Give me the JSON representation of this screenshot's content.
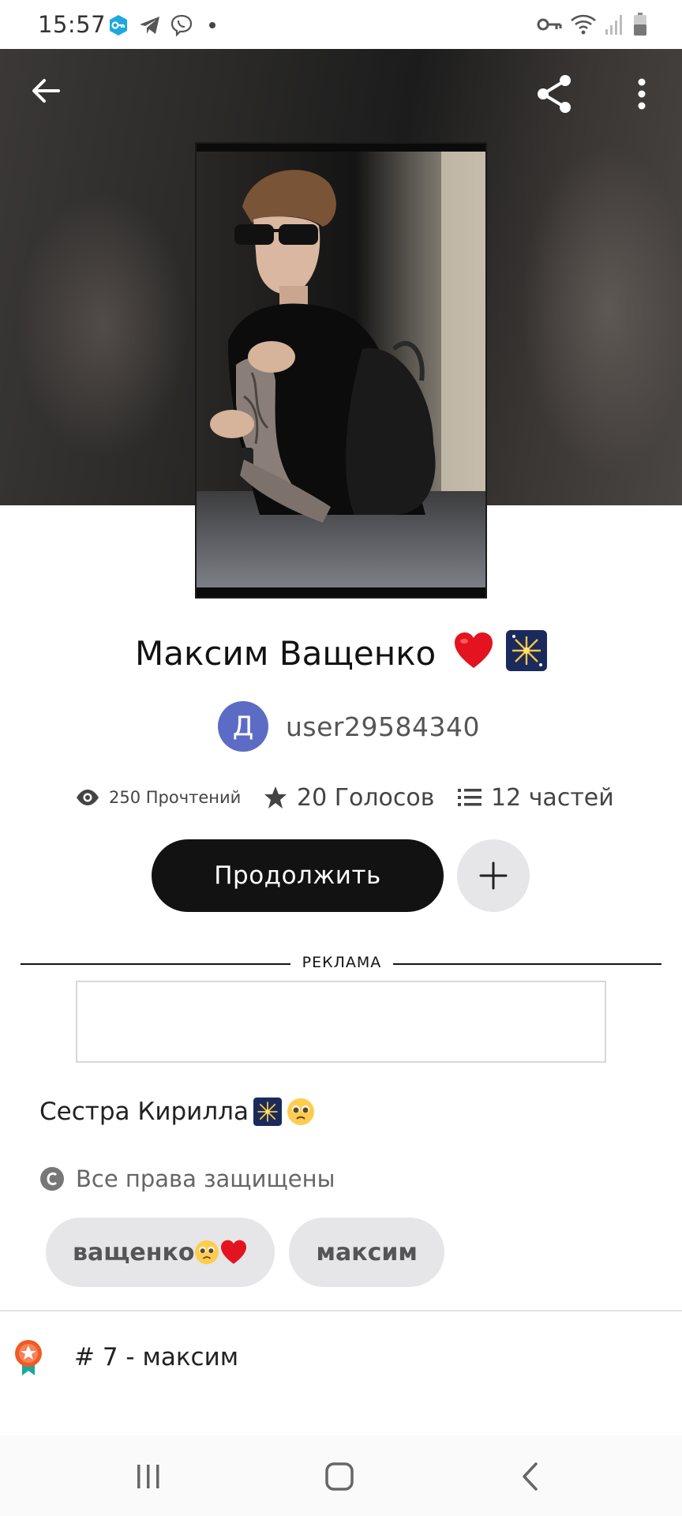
{
  "status_bar": {
    "time": "15:57",
    "left_icons": [
      "vpn-key-badge-icon",
      "telegram-icon",
      "viber-icon",
      "more-notifications-dot"
    ],
    "right_icons": [
      "vpn-key-icon",
      "wifi-icon",
      "signal-icon",
      "battery-icon"
    ]
  },
  "header": {
    "back_icon": "arrow-left-icon",
    "share_icon": "share-icon",
    "more_icon": "more-vertical-icon"
  },
  "story": {
    "title": "Максим Ващенко",
    "title_emojis": [
      "heart-emoji",
      "fireworks-emoji"
    ],
    "author_initial": "Д",
    "author_name": "user29584340",
    "reads": "250 Прочтений",
    "votes": "20 Голосов",
    "parts": "12 частей",
    "continue_label": "Продолжить",
    "description": "Сестра Кирилла",
    "description_emojis": [
      "fireworks-emoji",
      "pleading-face-emoji"
    ],
    "copyright": "Все права защищены"
  },
  "ad": {
    "label": "РЕКЛАМА"
  },
  "tags": [
    {
      "label": "ващенко",
      "emojis": [
        "pleading-face-emoji",
        "heart-emoji"
      ]
    },
    {
      "label": "максим"
    }
  ],
  "ranking": {
    "label": "# 7 - максим",
    "icon": "ranking-badge-icon"
  },
  "nav": {
    "icons": [
      "recent-apps-icon",
      "home-icon",
      "back-icon"
    ]
  },
  "colors": {
    "avatar_bg": "#5c6cc5",
    "continue_bg": "#121212",
    "tag_bg": "#e6e6e8",
    "badge_orange": "#f15a22",
    "badge_teal": "#1aa99b"
  }
}
